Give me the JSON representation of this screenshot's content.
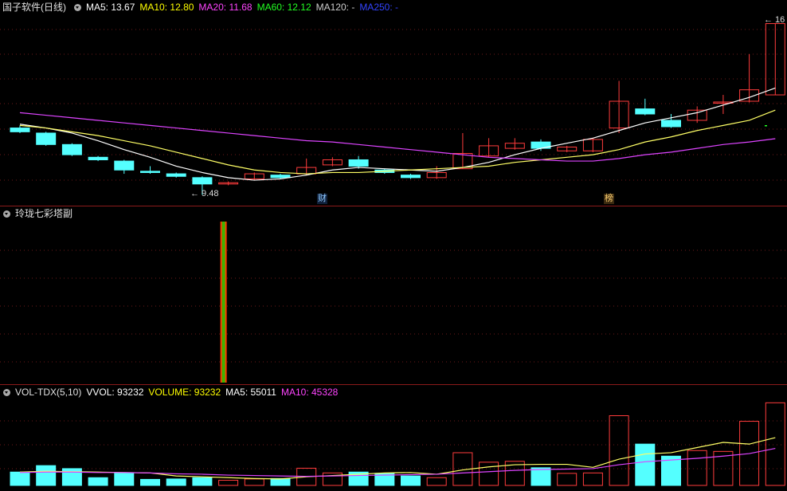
{
  "price_panel": {
    "stock_title": "国子软件(日线)",
    "indicators": [
      {
        "label": "MA5: 13.67",
        "color": "#ffffff"
      },
      {
        "label": "MA10: 12.80",
        "color": "#ffff00"
      },
      {
        "label": "MA20: 11.68",
        "color": "#ff44ff"
      },
      {
        "label": "MA60: 12.12",
        "color": "#22ff22"
      },
      {
        "label": "MA120: -",
        "color": "#cccccc"
      },
      {
        "label": "MA250: -",
        "color": "#3344ff"
      }
    ],
    "low_label": "← 9.48",
    "high_label": "← 16",
    "markers": {
      "cai": "财",
      "bang": "榜"
    }
  },
  "middle_panel": {
    "title": "玲珑七彩塔副"
  },
  "volume_panel": {
    "title": "VOL-TDX(5,10)",
    "indicators": [
      {
        "label": "VVOL: 93232",
        "color": "#ffffff"
      },
      {
        "label": "VOLUME: 93232",
        "color": "#ffff00"
      },
      {
        "label": "MA5: 55011",
        "color": "#ffffff"
      },
      {
        "label": "MA10: 45328",
        "color": "#ff44ff"
      }
    ]
  },
  "colors": {
    "up": "#ff3c3c",
    "down": "#54ffff",
    "grid": "#6e1a1a"
  },
  "chart_data": {
    "type": "candlestick",
    "candles": [
      {
        "o": 12.1,
        "c": 11.95,
        "h": 12.2,
        "l": 11.9
      },
      {
        "o": 11.9,
        "c": 11.45,
        "h": 11.95,
        "l": 11.4
      },
      {
        "o": 11.45,
        "c": 11.05,
        "h": 11.5,
        "l": 11.0
      },
      {
        "o": 10.95,
        "c": 10.85,
        "h": 11.0,
        "l": 10.8
      },
      {
        "o": 10.8,
        "c": 10.45,
        "h": 10.85,
        "l": 10.3
      },
      {
        "o": 10.4,
        "c": 10.35,
        "h": 10.6,
        "l": 10.3
      },
      {
        "o": 10.3,
        "c": 10.2,
        "h": 10.35,
        "l": 10.15
      },
      {
        "o": 10.15,
        "c": 9.9,
        "h": 10.2,
        "l": 9.48
      },
      {
        "o": 9.9,
        "c": 9.95,
        "h": 10.0,
        "l": 9.85
      },
      {
        "o": 10.1,
        "c": 10.3,
        "h": 10.35,
        "l": 10.05
      },
      {
        "o": 10.25,
        "c": 10.15,
        "h": 10.3,
        "l": 10.1
      },
      {
        "o": 10.3,
        "c": 10.55,
        "h": 10.9,
        "l": 10.25
      },
      {
        "o": 10.65,
        "c": 10.85,
        "h": 10.95,
        "l": 10.6
      },
      {
        "o": 10.85,
        "c": 10.6,
        "h": 11.0,
        "l": 10.5
      },
      {
        "o": 10.45,
        "c": 10.35,
        "h": 10.5,
        "l": 10.3
      },
      {
        "o": 10.25,
        "c": 10.15,
        "h": 10.3,
        "l": 10.1
      },
      {
        "o": 10.15,
        "c": 10.35,
        "h": 10.6,
        "l": 10.1
      },
      {
        "o": 10.5,
        "c": 11.1,
        "h": 11.9,
        "l": 10.5
      },
      {
        "o": 11.0,
        "c": 11.4,
        "h": 11.7,
        "l": 10.95
      },
      {
        "o": 11.3,
        "c": 11.5,
        "h": 11.7,
        "l": 11.25
      },
      {
        "o": 11.55,
        "c": 11.3,
        "h": 11.65,
        "l": 11.2
      },
      {
        "o": 11.2,
        "c": 11.35,
        "h": 11.4,
        "l": 11.15
      },
      {
        "o": 11.2,
        "c": 11.65,
        "h": 11.7,
        "l": 11.15
      },
      {
        "o": 12.1,
        "c": 13.15,
        "h": 13.95,
        "l": 11.9
      },
      {
        "o": 12.85,
        "c": 12.65,
        "h": 13.25,
        "l": 12.6
      },
      {
        "o": 12.4,
        "c": 12.15,
        "h": 12.65,
        "l": 12.1
      },
      {
        "o": 12.4,
        "c": 12.8,
        "h": 12.95,
        "l": 12.3
      },
      {
        "o": 13.1,
        "c": 13.12,
        "h": 13.4,
        "l": 12.65
      },
      {
        "o": 13.15,
        "c": 13.6,
        "h": 15.0,
        "l": 13.1
      },
      {
        "o": 13.4,
        "c": 16.2,
        "h": 16.2,
        "l": 13.4
      }
    ],
    "ma5": [
      12.25,
      12.1,
      11.9,
      11.6,
      11.25,
      10.95,
      10.6,
      10.35,
      10.15,
      10.05,
      10.1,
      10.25,
      10.45,
      10.55,
      10.5,
      10.45,
      10.4,
      10.55,
      10.75,
      11.05,
      11.3,
      11.5,
      11.7,
      12.0,
      12.3,
      12.5,
      12.7,
      13.0,
      13.3,
      13.67
    ],
    "ma10": [
      12.2,
      12.1,
      11.95,
      11.8,
      11.6,
      11.4,
      11.15,
      10.9,
      10.65,
      10.45,
      10.35,
      10.3,
      10.35,
      10.35,
      10.4,
      10.45,
      10.5,
      10.55,
      10.6,
      10.75,
      10.85,
      10.95,
      11.05,
      11.25,
      11.55,
      11.75,
      12.0,
      12.2,
      12.4,
      12.8
    ],
    "ma20": [
      12.7,
      12.6,
      12.5,
      12.4,
      12.3,
      12.2,
      12.1,
      12.0,
      11.9,
      11.8,
      11.7,
      11.6,
      11.55,
      11.45,
      11.35,
      11.25,
      11.15,
      11.05,
      10.95,
      10.9,
      10.85,
      10.8,
      10.8,
      10.9,
      11.05,
      11.15,
      11.3,
      11.45,
      11.55,
      11.68
    ],
    "volume": [
      3.1,
      4.6,
      3.9,
      1.8,
      2.9,
      1.4,
      1.5,
      1.8,
      1.2,
      1.5,
      1.6,
      4.0,
      2.9,
      3.1,
      2.8,
      2.2,
      1.8,
      7.6,
      5.4,
      5.6,
      4.1,
      2.8,
      2.9,
      16.2,
      9.6,
      6.8,
      8.1,
      7.9,
      14.9,
      19.2
    ],
    "vol_ma5": [
      3.1,
      3.3,
      3.2,
      3.1,
      3.0,
      2.9,
      2.2,
      2.0,
      1.8,
      1.6,
      1.5,
      2.0,
      2.3,
      2.6,
      2.9,
      3.0,
      2.6,
      3.6,
      4.3,
      4.8,
      4.9,
      4.9,
      4.2,
      6.1,
      7.3,
      7.6,
      8.8,
      10.0,
      9.6,
      11.1
    ],
    "vol_ma10": [
      3.0,
      3.1,
      3.1,
      3.0,
      3.0,
      2.9,
      2.7,
      2.6,
      2.4,
      2.3,
      2.2,
      2.1,
      2.2,
      2.3,
      2.4,
      2.5,
      2.6,
      2.9,
      3.2,
      3.5,
      3.7,
      3.8,
      3.9,
      4.8,
      5.5,
      5.9,
      6.3,
      6.8,
      7.4,
      8.6
    ],
    "spike_index": 8
  }
}
